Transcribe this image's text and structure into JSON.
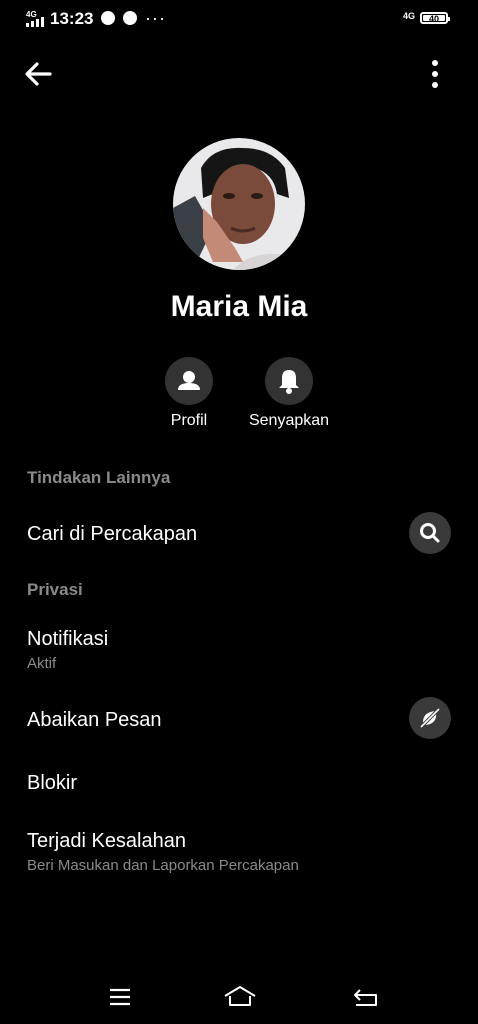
{
  "status_bar": {
    "time": "13:23",
    "network_left": "4G",
    "network_right": "4G",
    "battery": "40",
    "more": "···"
  },
  "contact": {
    "name": "Maria Mia"
  },
  "actions": [
    {
      "label": "Profil",
      "icon": "person-icon"
    },
    {
      "label": "Senyapkan",
      "icon": "bell-icon"
    }
  ],
  "sections": {
    "more_actions": "Tindakan Lainnya",
    "privacy": "Privasi"
  },
  "items": {
    "search": {
      "title": "Cari di Percakapan",
      "icon": "search-icon"
    },
    "notifications": {
      "title": "Notifikasi",
      "subtitle": "Aktif"
    },
    "ignore": {
      "title": "Abaikan Pesan",
      "icon": "ignore-icon"
    },
    "block": {
      "title": "Blokir"
    },
    "report": {
      "title": "Terjadi Kesalahan",
      "subtitle": "Beri Masukan dan Laporkan Percakapan"
    }
  },
  "colors": {
    "background": "#000000",
    "secondary_text": "#8a8a8a",
    "button_bg": "#333333"
  }
}
